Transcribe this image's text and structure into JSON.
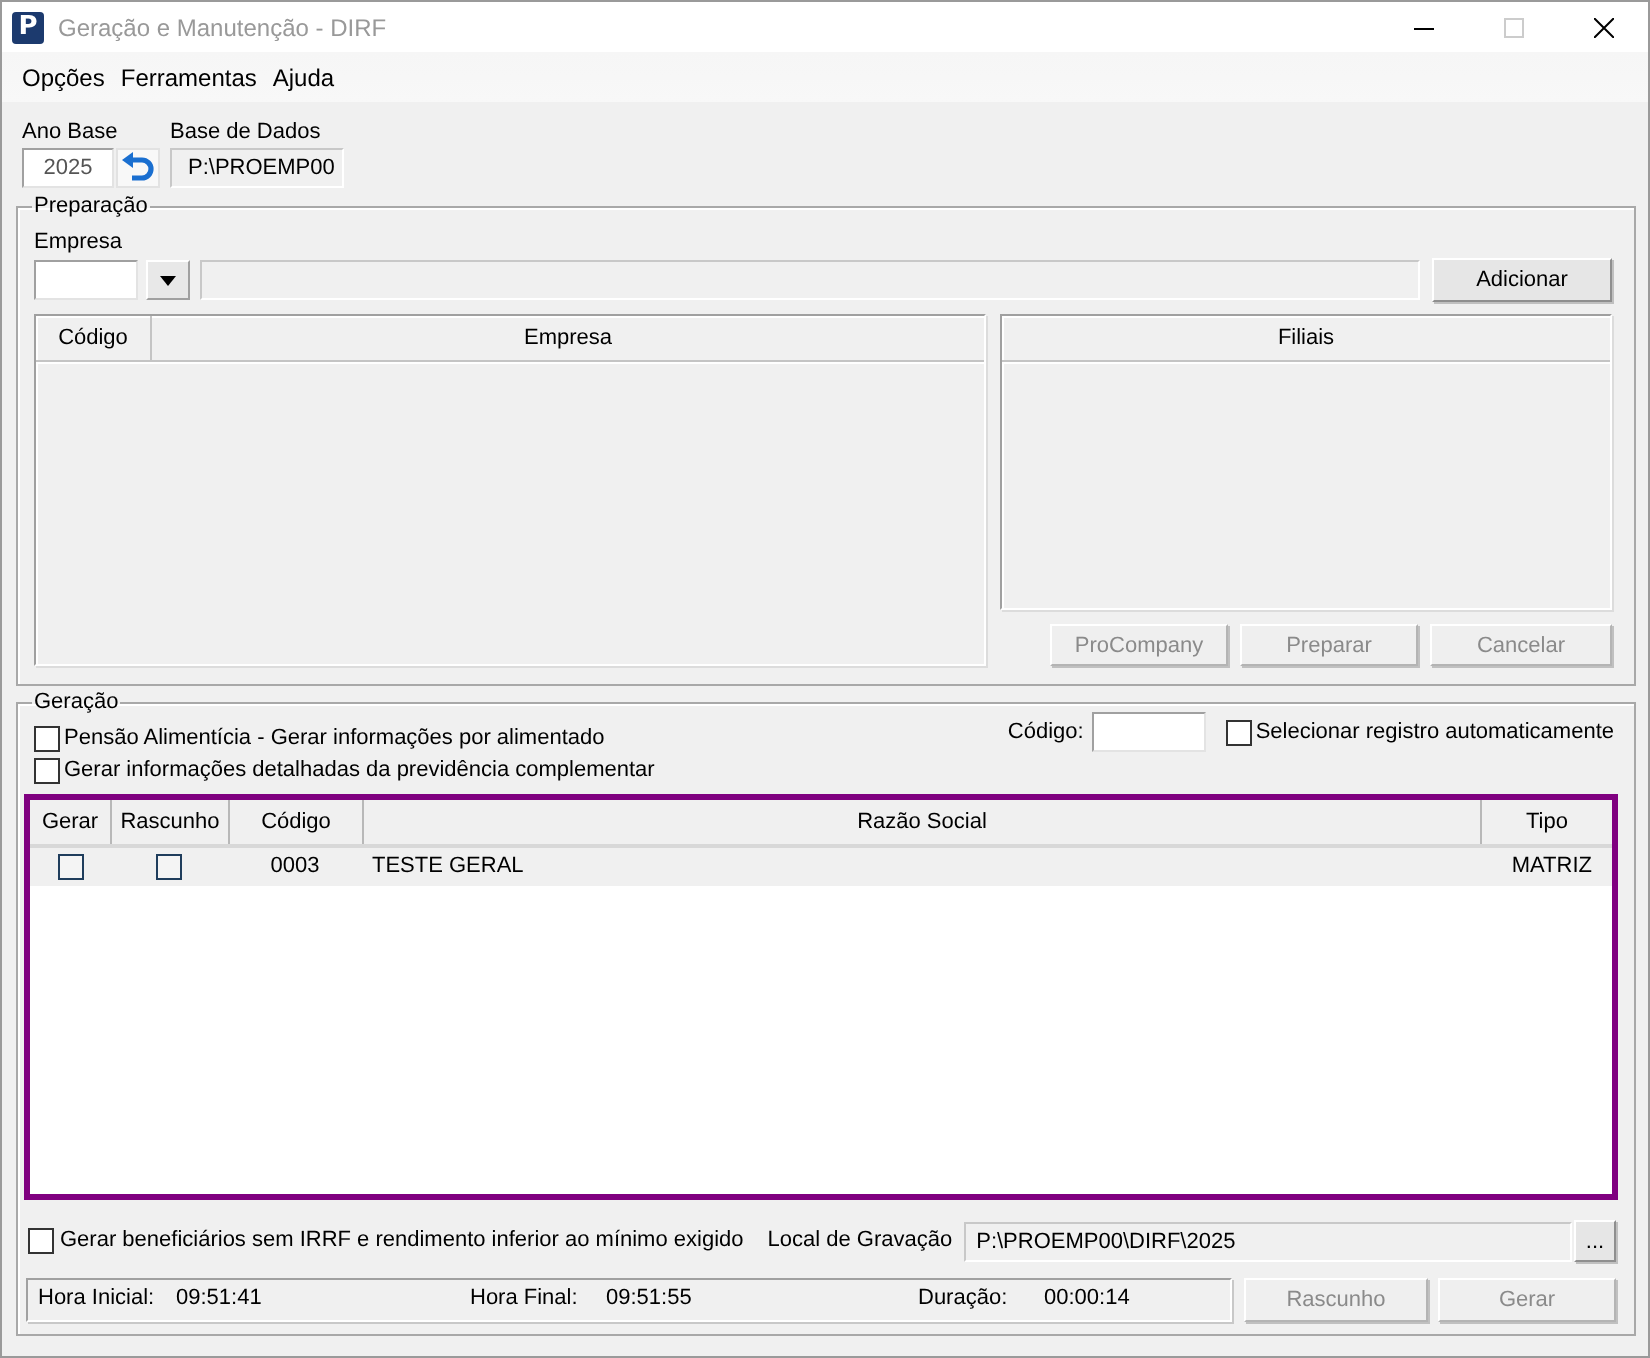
{
  "window": {
    "logo": "P",
    "title": "Geração e Manutenção - DIRF",
    "focused": false,
    "controls": [
      {
        "kind": "minimize",
        "disabled": false
      },
      {
        "kind": "maximize",
        "disabled": true
      },
      {
        "kind": "close",
        "disabled": false
      }
    ]
  },
  "menu": [
    {
      "label": "Opções"
    },
    {
      "label": "Ferramentas"
    },
    {
      "label": "Ajuda"
    }
  ],
  "header": {
    "ano_base": {
      "label": "Ano Base",
      "value": "2025"
    },
    "base_de_dados": {
      "label": "Base de Dados",
      "value": "P:\\PROEMP00"
    }
  },
  "preparacao": {
    "title": "Preparação",
    "empresa_label": "Empresa",
    "add_button": {
      "label": "Adicionar",
      "disabled": false
    },
    "empresas_table": {
      "columns": [
        "Código",
        "Empresa"
      ]
    },
    "filiais_table": {
      "columns": [
        "Filiais"
      ]
    },
    "buttons": [
      {
        "label": "ProCompany",
        "disabled": true
      },
      {
        "label": "Preparar",
        "disabled": true
      },
      {
        "label": "Cancelar",
        "disabled": true
      }
    ]
  },
  "geracao": {
    "title": "Geração",
    "options": [
      {
        "label": "Pensão Alimentícia - Gerar informações por alimentado",
        "checked": false
      },
      {
        "label": "Gerar informações detalhadas da previdência complementar",
        "checked": false
      }
    ],
    "codigo": {
      "label": "Código:"
    },
    "auto_select": {
      "label": "Selecionar registro automaticamente",
      "checked": false
    },
    "table": {
      "columns": [
        "Gerar",
        "Rascunho",
        "Código",
        "Razão Social",
        "Tipo"
      ],
      "rows": [
        {
          "gerar": false,
          "rascunho": false,
          "codigo": "0003",
          "razao_social": "TESTE GERAL",
          "tipo": "MATRIZ"
        }
      ]
    },
    "beneficiarios": {
      "label": "Gerar beneficiários sem IRRF e rendimento inferior ao mínimo exigido",
      "checked": false
    },
    "local": {
      "label": "Local de Gravação",
      "value": "P:\\PROEMP00\\DIRF\\2025",
      "browse": {
        "label": "...",
        "disabled": false
      }
    },
    "status": [
      {
        "label": "Hora Inicial:",
        "value": "09:51:41"
      },
      {
        "label": "Hora Final:",
        "value": "09:51:55"
      },
      {
        "label": "Duração:",
        "value": "00:00:14"
      }
    ],
    "buttons": [
      {
        "label": "Rascunho",
        "disabled": true
      },
      {
        "label": "Gerar",
        "disabled": true
      }
    ]
  }
}
